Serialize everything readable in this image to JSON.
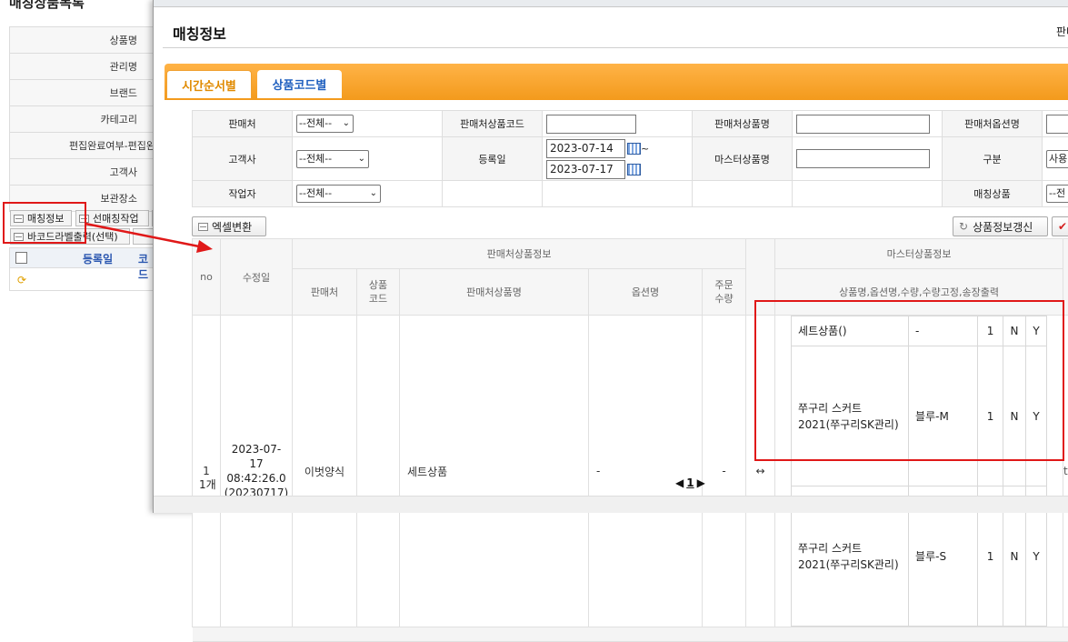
{
  "background": {
    "title": "매칭상품목록",
    "form_labels": [
      "상품명",
      "관리명",
      "브랜드",
      "카테고리",
      "편집완료여부-편집완",
      "고객사",
      "보관장소"
    ],
    "buttons": {
      "matching_info": "매칭정보",
      "pre_matching": "선매칭작업",
      "barcode_print": "바코드라벨출력(선택)"
    },
    "grid_headers": {
      "reg_date": "등록일",
      "code": "코드"
    }
  },
  "popup": {
    "title": "매칭정보",
    "title_right": "판매",
    "tabs": [
      {
        "label": "시간순서별",
        "active": true
      },
      {
        "label": "상품코드별",
        "active": false
      }
    ],
    "search": {
      "seller_label": "판매처",
      "seller_value": "--전체--",
      "seller_code_label": "판매처상품코드",
      "seller_code_value": "",
      "seller_name_label": "판매처상품명",
      "seller_name_value": "",
      "seller_option_label": "판매처옵션명",
      "seller_option_value": "",
      "customer_label": "고객사",
      "customer_value": "--전체--",
      "reg_date_label": "등록일",
      "date_from": "2023-07-14",
      "date_sep": "~",
      "date_to": "2023-07-17",
      "master_name_label": "마스터상품명",
      "master_name_value": "",
      "type_label": "구분",
      "type_value": "사용",
      "worker_label": "작업자",
      "worker_value": "--전체--",
      "matching_label": "매칭상품",
      "matching_value": "--전"
    },
    "toolbar": {
      "excel": "엑셀변환",
      "refresh": "상품정보갱신"
    },
    "grid": {
      "headers": {
        "no": "no",
        "modified": "수정일",
        "seller_group": "판매처상품정보",
        "master_group": "마스터상품정보",
        "seller": "판매처",
        "product_code": "상품\n코드",
        "seller_product": "판매처상품명",
        "option": "옵션명",
        "order_qty": "주문\n수량",
        "master_cols": "상품명,옵션명,수량,수량고정,송장출력"
      },
      "row": {
        "no": "1",
        "date": "2023-07-\n17\n08:42:26.0\n(20230717)",
        "seller": "이벗양식",
        "code": "",
        "product": "세트상품",
        "option": "-",
        "qty": "-",
        "arrow": "↔",
        "trailing": "th"
      },
      "master_rows": [
        {
          "name": "세트상품()",
          "option": "-",
          "qty": "1",
          "fixed": "N",
          "print": "Y"
        },
        {
          "name": "쭈구리 스커트\n2021(쭈구리SK관리)",
          "option": "블루-M",
          "qty": "1",
          "fixed": "N",
          "print": "Y"
        },
        {
          "name": "쭈구리 스커트\n2021(쭈구리SK관리)",
          "option": "블루-S",
          "qty": "1",
          "fixed": "N",
          "print": "Y"
        }
      ]
    },
    "pager": {
      "count": "1개",
      "prev": "◀",
      "page": "1",
      "next": "▶"
    }
  },
  "colors": {
    "tab_orange": "#f39a1c",
    "tab_active_text": "#e08a00",
    "tab_inactive_text": "#1f5fbf",
    "annotation_red": "#e01818"
  }
}
